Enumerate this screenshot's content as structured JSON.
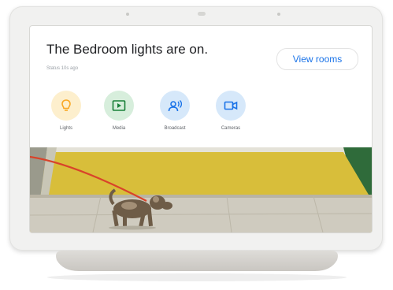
{
  "notification": {
    "headline": "The Bedroom lights are on.",
    "subline": "Status 10s ago",
    "view_rooms_label": "View rooms"
  },
  "quick_actions": [
    {
      "label": "Lights",
      "icon": "bulb-icon",
      "color": "#f9a825",
      "bg": "#fdefcd"
    },
    {
      "label": "Media",
      "icon": "play-icon",
      "color": "#188038",
      "bg": "#d7eedc"
    },
    {
      "label": "Broadcast",
      "icon": "broadcast-icon",
      "color": "#1a73e8",
      "bg": "#d6e8fa"
    },
    {
      "label": "Cameras",
      "icon": "camera-icon",
      "color": "#1a73e8",
      "bg": "#d6e8fa"
    }
  ],
  "colors": {
    "accent": "#1a73e8",
    "wall": "#d8be3a",
    "leash": "#d9432a"
  }
}
